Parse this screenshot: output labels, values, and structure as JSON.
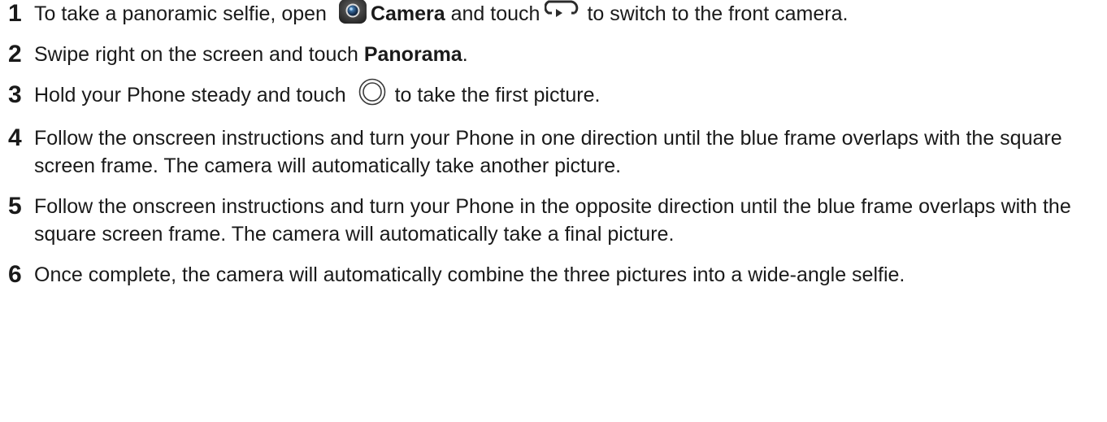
{
  "steps": [
    {
      "num": "1",
      "t1": "To take a panoramic selfie, open",
      "app": "Camera",
      "t2": "and touch",
      "t3": "to switch to the front camera."
    },
    {
      "num": "2",
      "t1": "Swipe right on the screen and touch",
      "bold": "Panorama",
      "t2": "."
    },
    {
      "num": "3",
      "t1": "Hold your Phone steady and touch",
      "t2": "to take the first picture."
    },
    {
      "num": "4",
      "text": "Follow the onscreen instructions and turn your Phone in one direction until the blue frame overlaps with the square screen frame. The camera will automatically take another picture."
    },
    {
      "num": "5",
      "text": "Follow the onscreen instructions and turn your Phone in the opposite direction until the blue frame overlaps with the square screen frame. The camera will automatically take a final picture."
    },
    {
      "num": "6",
      "text": "Once complete, the camera will automatically combine the three pictures into a wide-angle selfie."
    }
  ],
  "icons": {
    "camera_app": "camera-app-icon",
    "switch_camera": "switch-camera-icon",
    "shutter": "shutter-icon"
  },
  "colors": {
    "text": "#1a1a1a",
    "icon_dark": "#2b2b2b"
  }
}
